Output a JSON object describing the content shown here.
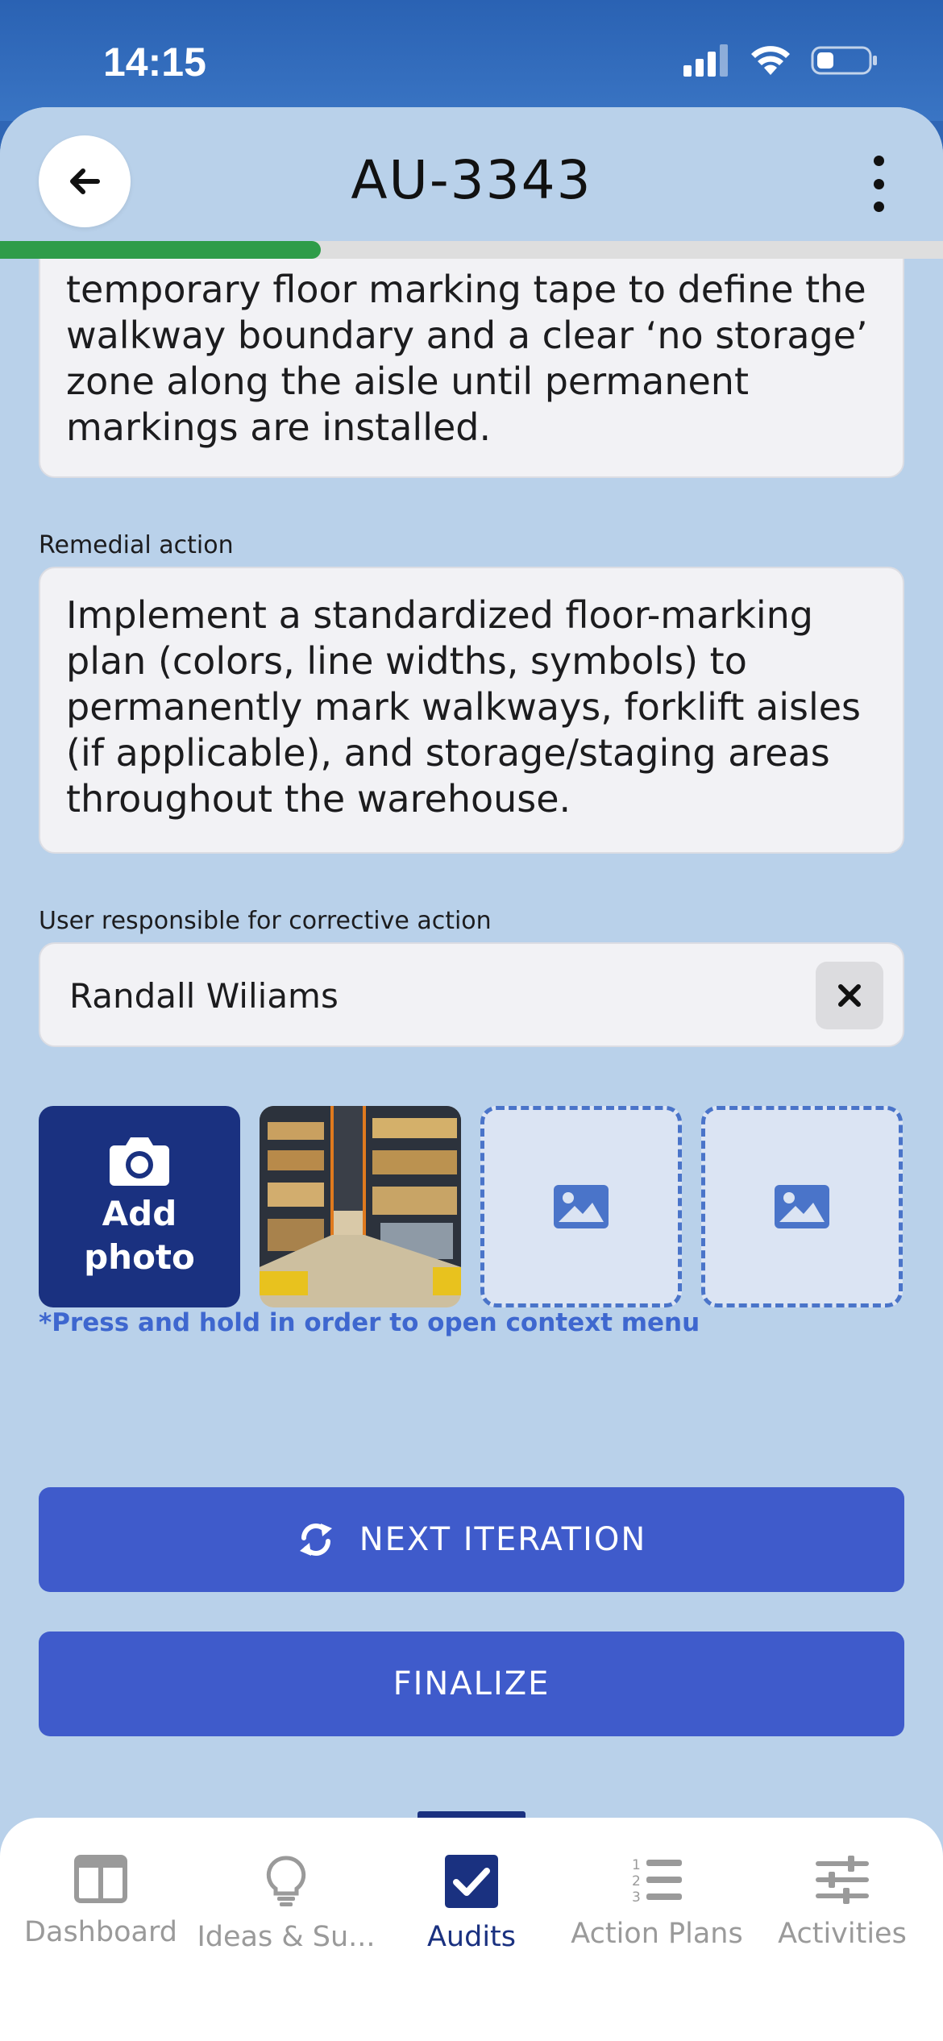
{
  "status_bar": {
    "time": "14:15"
  },
  "header": {
    "title": "AU-3343",
    "progress_fraction": 0.34
  },
  "observation": {
    "lines": [
      "temporary floor marking tape to define the",
      "walkway boundary and a clear ‘no storage’",
      "zone along the aisle until permanent",
      "markings are installed."
    ]
  },
  "remedial": {
    "label": "Remedial action",
    "text": "Implement a standardized floor-marking plan (colors, line widths, symbols) to permanently mark walkways, forklift aisles (if applicable), and storage/staging areas throughout the warehouse."
  },
  "responsible": {
    "label": "User responsible for corrective action",
    "value": "Randall Wiliams"
  },
  "photos": {
    "add_label": "Add photo",
    "hint": "*Press and hold in order to open context menu"
  },
  "buttons": {
    "next_iteration": "NEXT ITERATION",
    "finalize": "FINALIZE"
  },
  "tabs": [
    {
      "label": "Dashboard",
      "icon": "dashboard-icon"
    },
    {
      "label": "Ideas & Su...",
      "icon": "lightbulb-icon"
    },
    {
      "label": "Audits",
      "icon": "checkbox-icon",
      "active": true
    },
    {
      "label": "Action Plans",
      "icon": "numbered-list-icon"
    },
    {
      "label": "Activities",
      "icon": "sliders-icon"
    }
  ],
  "colors": {
    "primary_button": "#3f5bcb",
    "dark_navy": "#1a3180",
    "background": "#b9d1ea",
    "progress": "#2f9c49",
    "hint_text": "#3e67cf"
  }
}
